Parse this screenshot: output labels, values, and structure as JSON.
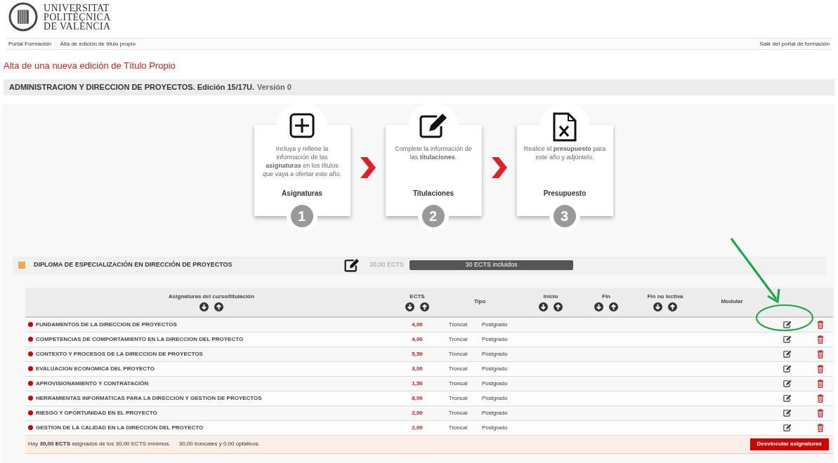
{
  "logo": {
    "lines": [
      "UNIVERSITAT",
      "POLITÈCNICA",
      "DE VALÈNCIA"
    ]
  },
  "breadcrumb": [
    "Portal Formación",
    "Alta de edición de título propio"
  ],
  "breadcrumb_separator": "::",
  "exit_link": "Salir del portal de formación",
  "page_title": "Alta de una nueva edición de Título Propio",
  "edition": {
    "title": "ADMINISTRACION Y DIRECCION DE PROYECTOS. Edición 15/17U.",
    "version": "Versión 0"
  },
  "steps": [
    {
      "kind": "add",
      "text": "Incluya y rellene la información de las **asignaturas** en los títulos que vaya a ofertar este año.",
      "label": "Asignaturas",
      "number": "1"
    },
    {
      "kind": "edit",
      "text": "Complete la información de las **titulaciones**.",
      "label": "Titulaciones",
      "number": "2"
    },
    {
      "kind": "excel",
      "text": "Realice el **presupuesto** para este año y adjúntelo.",
      "label": "Presupuesto",
      "number": "3"
    }
  ],
  "diploma": {
    "title": "DIPLOMA DE ESPECIALIZACIÓN EN DIRECCIÓN DE PROYECTOS",
    "color": "#f0a848",
    "ects": "30,00 ECTS",
    "bar": {
      "label": "30 ECTS incluidos",
      "level": 1
    }
  },
  "table": {
    "columns": [
      {
        "label": "Asignaturas del curso/titulación",
        "sortable": true
      },
      {
        "label": "ECTS",
        "sortable": true
      },
      {
        "label": "Tipo",
        "sortable": false
      },
      {
        "label": "Inicio",
        "sortable": true
      },
      {
        "label": "Fin",
        "sortable": true
      },
      {
        "label": "Fin no lectiva",
        "sortable": true
      },
      {
        "label": "Modular",
        "sortable": false
      }
    ],
    "rows": [
      {
        "name": "FUNDAMENTOS DE LA DIRECCION DE PROYECTOS",
        "ects": "4,00",
        "type": "Troncal",
        "level": "Postgrado"
      },
      {
        "name": "COMPETENCIAS DE COMPORTAMIENTO EN LA DIRECCION DEL PROYECTO",
        "ects": "4,00",
        "type": "Troncal",
        "level": "Postgrado"
      },
      {
        "name": "CONTEXTO Y PROCESOS DE LA DIRECCION DE PROYECTOS",
        "ects": "5,50",
        "type": "Troncal",
        "level": "Postgrado"
      },
      {
        "name": "EVALUACION ECONOMICA DEL PROYECTO",
        "ects": "3,00",
        "type": "Troncal",
        "level": "Postgrado"
      },
      {
        "name": "APROVISIONAMIENTO Y CONTRATACIÓN",
        "ects": "1,50",
        "type": "Troncal",
        "level": "Postgrado"
      },
      {
        "name": "HERRAMIENTAS INFORMATICAS PARA LA DIRECCION Y GESTION DE PROYECTOS",
        "ects": "8,00",
        "type": "Troncal",
        "level": "Postgrado"
      },
      {
        "name": "RIESGO Y OPORTUNIDAD EN EL PROYECTO",
        "ects": "2,00",
        "type": "Troncal",
        "level": "Postgrado"
      },
      {
        "name": "GESTION DE LA CALIDAD EN LA DIRECCION DEL PROYECTO",
        "ects": "2,00",
        "type": "Troncal",
        "level": "Postgrado"
      }
    ],
    "summary": "Hay **30,00 ECTS** asignados de los 30,00 ECTS mínimos.",
    "summary_detail": "30,00 troncales y 0,00 optativos.",
    "button": "Desvincular asignaturas"
  },
  "annotation": {
    "kind": "arrow_circle"
  }
}
